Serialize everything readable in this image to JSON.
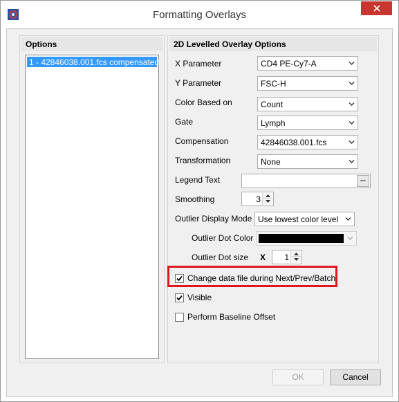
{
  "window": {
    "title": "Formatting Overlays",
    "close_icon": "close-icon",
    "app_icon": "fcs-express-logo-icon"
  },
  "options_panel": {
    "header": "Options",
    "items": [
      "1 - 42846038.001.fcs compensated"
    ]
  },
  "overlay_panel": {
    "header": "2D Levelled Overlay Options",
    "x_parameter": {
      "label": "X Parameter",
      "value": "CD4 PE-Cy7-A"
    },
    "y_parameter": {
      "label": "Y Parameter",
      "value": "FSC-H"
    },
    "color_based_on": {
      "label": "Color Based on",
      "value": "Count"
    },
    "gate": {
      "label": "Gate",
      "value": "Lymph"
    },
    "compensation": {
      "label": "Compensation",
      "value": "42846038.001.fcs"
    },
    "transformation": {
      "label": "Transformation",
      "value": "None"
    },
    "legend_text": {
      "label": "Legend Text",
      "value": "",
      "button": "..."
    },
    "smoothing": {
      "label": "Smoothing",
      "value": "3"
    },
    "outlier_display_mode": {
      "label": "Outlier Display Mode",
      "value": "Use lowest color level"
    },
    "outlier_dot_color": {
      "label": "Outlier Dot Color",
      "color": "#000000"
    },
    "outlier_dot_size": {
      "label": "Outlier Dot size",
      "prefix": "X",
      "value": "1"
    },
    "change_data_file": {
      "label": "Change data file during Next/Prev/Batch",
      "checked": true
    },
    "visible": {
      "label": "Visible",
      "checked": true
    },
    "baseline_offset": {
      "label": "Perform Baseline Offset",
      "checked": false
    }
  },
  "buttons": {
    "ok": "OK",
    "cancel": "Cancel"
  },
  "colors": {
    "highlight": "#e0161f",
    "selection": "#3399ff",
    "close": "#c7372f"
  }
}
